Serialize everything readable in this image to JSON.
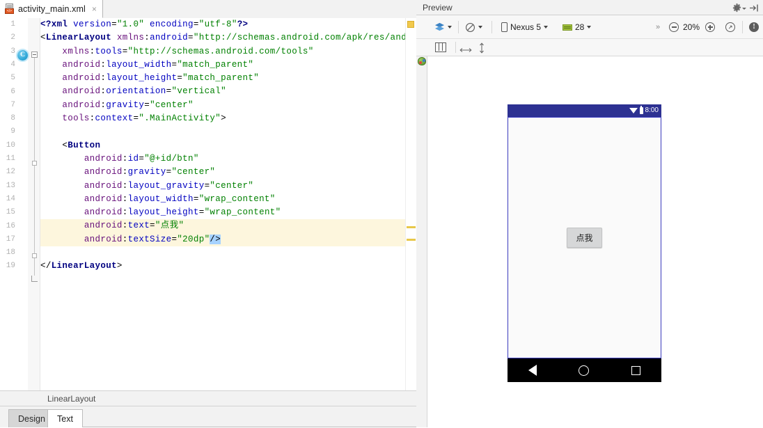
{
  "editor": {
    "tab": {
      "filename": "activity_main.xml",
      "close_label": "×",
      "icon": "xml-file-icon"
    },
    "breadcrumb": "LinearLayout",
    "mode_tabs": [
      {
        "label": "Design",
        "active": false
      },
      {
        "label": "Text",
        "active": true
      }
    ],
    "gutter_marker": {
      "line": 2,
      "glyph": "C"
    },
    "highlighted_lines": [
      16,
      17
    ],
    "lines": [
      {
        "n": 1,
        "text": "<?xml version=\"1.0\" encoding=\"utf-8\"?>"
      },
      {
        "n": 2,
        "text": "<LinearLayout xmlns:android=\"http://schemas.android.com/apk/res/android\""
      },
      {
        "n": 3,
        "text": "    xmlns:tools=\"http://schemas.android.com/tools\""
      },
      {
        "n": 4,
        "text": "    android:layout_width=\"match_parent\""
      },
      {
        "n": 5,
        "text": "    android:layout_height=\"match_parent\""
      },
      {
        "n": 6,
        "text": "    android:orientation=\"vertical\""
      },
      {
        "n": 7,
        "text": "    android:gravity=\"center\""
      },
      {
        "n": 8,
        "text": "    tools:context=\".MainActivity\">"
      },
      {
        "n": 9,
        "text": ""
      },
      {
        "n": 10,
        "text": "    <Button"
      },
      {
        "n": 11,
        "text": "        android:id=\"@+id/btn\""
      },
      {
        "n": 12,
        "text": "        android:gravity=\"center\""
      },
      {
        "n": 13,
        "text": "        android:layout_gravity=\"center\""
      },
      {
        "n": 14,
        "text": "        android:layout_width=\"wrap_content\""
      },
      {
        "n": 15,
        "text": "        android:layout_height=\"wrap_content\""
      },
      {
        "n": 16,
        "text": "        android:text=\"点我\""
      },
      {
        "n": 17,
        "text": "        android:textSize=\"20dp\"/>"
      },
      {
        "n": 18,
        "text": ""
      },
      {
        "n": 19,
        "text": "</LinearLayout>"
      }
    ]
  },
  "preview": {
    "title": "Preview",
    "gear_icon": "gear-icon",
    "minimize_icon": "minimize-icon",
    "palette_label": "Palette",
    "toolbar": {
      "layers_label": "",
      "theme_label": "",
      "device_label": "Nexus 5",
      "api_label": "28",
      "overflow_label": "»",
      "zoom_out_label": "−",
      "zoom_value": "20%",
      "zoom_in_label": "+",
      "zoom_fit_label": "",
      "warning_label": "!"
    },
    "device": {
      "status_time": "8:00",
      "wifi_icon": "wifi-icon",
      "battery_icon": "battery-icon",
      "button_text": "点我",
      "nav_back": "back-icon",
      "nav_home": "home-icon",
      "nav_recents": "recents-icon"
    }
  },
  "colors": {
    "tag": "#000080",
    "attribute": "#0000c0",
    "value": "#008000",
    "namespace": "#660e7a",
    "highlight": "#fdf6dd",
    "status_bar": "#2d3192",
    "accent": "#2fa8d8"
  }
}
